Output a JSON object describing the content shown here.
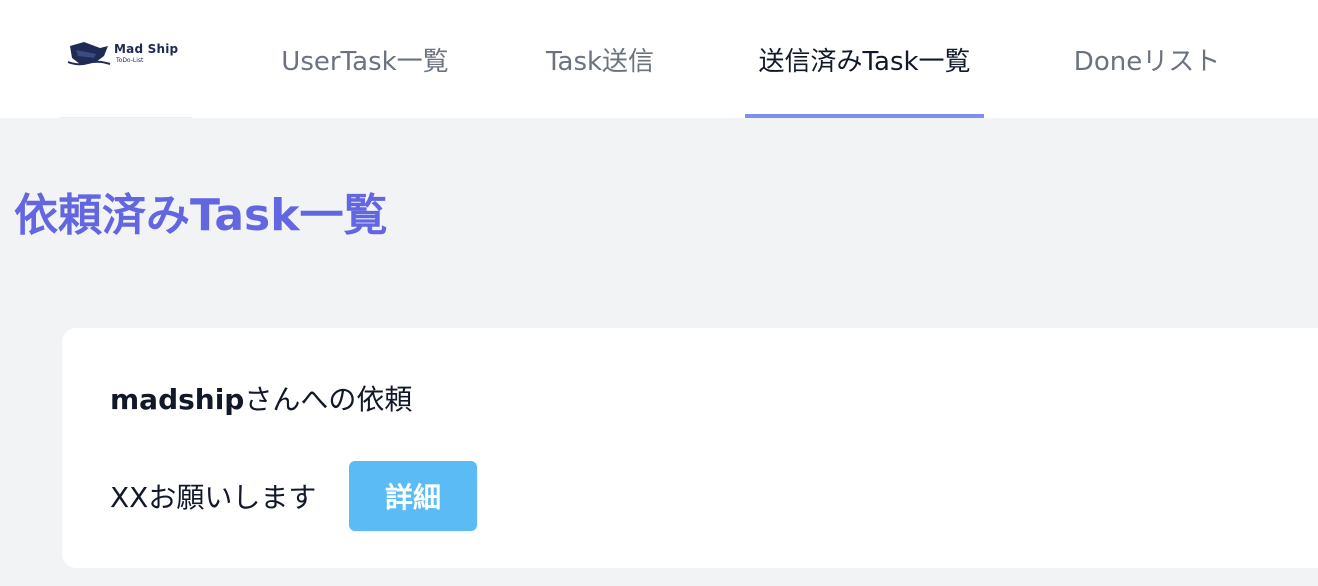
{
  "navbar": {
    "logo": {
      "title": "Mad Ship",
      "subtitle": "ToDo-List",
      "icon": "ship-icon",
      "color": "#1f2a55"
    },
    "tabs": [
      {
        "label": "UserTask一覧",
        "active": false
      },
      {
        "label": "Task送信",
        "active": false
      },
      {
        "label": "送信済みTask一覧",
        "active": true
      },
      {
        "label": "Doneリスト",
        "active": false
      }
    ],
    "active_indicator_color": "#7f8ff0"
  },
  "main": {
    "title": "依頼済みTask一覧",
    "title_color": "#6366e1",
    "cards": [
      {
        "recipient_name": "madship",
        "recipient_suffix": "さんへの依頼",
        "task_text": "XXお願いします",
        "detail_label": "詳細",
        "detail_color": "#5bbcf5"
      }
    ]
  }
}
